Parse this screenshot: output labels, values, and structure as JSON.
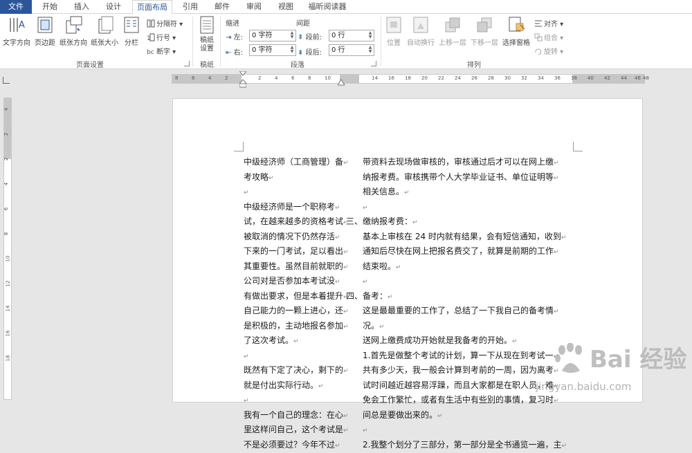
{
  "tabs": [
    "文件",
    "开始",
    "插入",
    "设计",
    "页面布局",
    "引用",
    "邮件",
    "审阅",
    "视图",
    "福昕阅读器"
  ],
  "ribbon": {
    "page_setup": {
      "buttons": [
        "文字方向",
        "页边距",
        "纸张方向",
        "纸张大小",
        "分栏"
      ],
      "small": [
        "分隔符",
        "行号",
        "断字"
      ],
      "label": "页面设置"
    },
    "draft": {
      "button": "稿纸\n设置",
      "label": "稿纸"
    },
    "paragraph": {
      "indent_title": "缩进",
      "spacing_title": "间距",
      "left_label": "左:",
      "right_label": "右:",
      "before_label": "段前:",
      "after_label": "段后:",
      "left_value": "0 字符",
      "right_value": "0 字符",
      "before_value": "0 行",
      "after_value": "0 行",
      "label": "段落"
    },
    "arrange": {
      "buttons": [
        "位置",
        "自动换行",
        "上移一层",
        "下移一层",
        "选择窗格"
      ],
      "small": [
        "对齐",
        "组合",
        "旋转"
      ],
      "label": "排列"
    }
  },
  "ruler": {
    "h_ticks": [
      "8",
      "6",
      "4",
      "2",
      "2",
      "4",
      "6",
      "8",
      "10",
      "14",
      "16",
      "18",
      "20",
      "22",
      "24",
      "26",
      "28",
      "30",
      "32",
      "34",
      "36",
      "38",
      "40",
      "42",
      "44",
      "46",
      "48"
    ],
    "v_ticks": [
      "4",
      "2",
      "2",
      "4",
      "6",
      "8",
      "10",
      "12",
      "14",
      "16",
      "18"
    ]
  },
  "document": {
    "left_column": [
      "中级经济师（工商管理）备",
      "考攻略",
      "",
      "中级经济师是一个职称考",
      "试，在越来越多的资格考试",
      "被取消的情况下仍然存活",
      "下来的一门考试，足以看出",
      "其重要性。虽然目前就职的",
      "公司对是否参加本考试没",
      "有做出要求，但是本着提升",
      "自己能力的一颗上进心，还",
      "是积极的，主动地报名参加",
      "了这次考试。",
      "",
      "既然有下定了决心，剩下的",
      "就是付出实际行动。",
      "",
      "我有一个自己的理念：在心",
      "里这样问自己，这个考试是",
      "不是必须要过？今年不过"
    ],
    "right_column": [
      "带资料去现场做审核的，审核通过后才可以在网上缴",
      "纳报考费。审核携带个人大学毕业证书、单位证明等",
      "相关信息。",
      "",
      "三、缴纳报考费：",
      "基本上审核在 24 时内就有结果，会有短信通知，收到",
      "通知后尽快在网上把报名费交了，就算是前期的工作",
      "结束啦。",
      "",
      "四、备考：",
      "这是最最重要的工作了，总结了一下我自己的备考情",
      "况。",
      "送网上缴费成功开始就是我备考的开始。",
      "1.首先是做整个考试的计划，算一下从现在到考试一",
      "共有多少天，我一般会计算到考前的一周，因为离考",
      "试时间越近越容易浮躁，而且大家都是在职人员，难",
      "免会工作繁忙，或者有生活中有些别的事情，复习时",
      "间总是要做出来的。",
      "",
      "2.我整个划分了三部分，第一部分是全书通览一遍，主"
    ],
    "paragraph_mark": "↵"
  },
  "watermark": {
    "main": "Bai 经验",
    "sub": "jingyan.baidu.com"
  },
  "colors": {
    "file_tab": "#2b579a",
    "active_tab_text": "#2b579a",
    "wavy_underline": "#3c6ad3"
  }
}
